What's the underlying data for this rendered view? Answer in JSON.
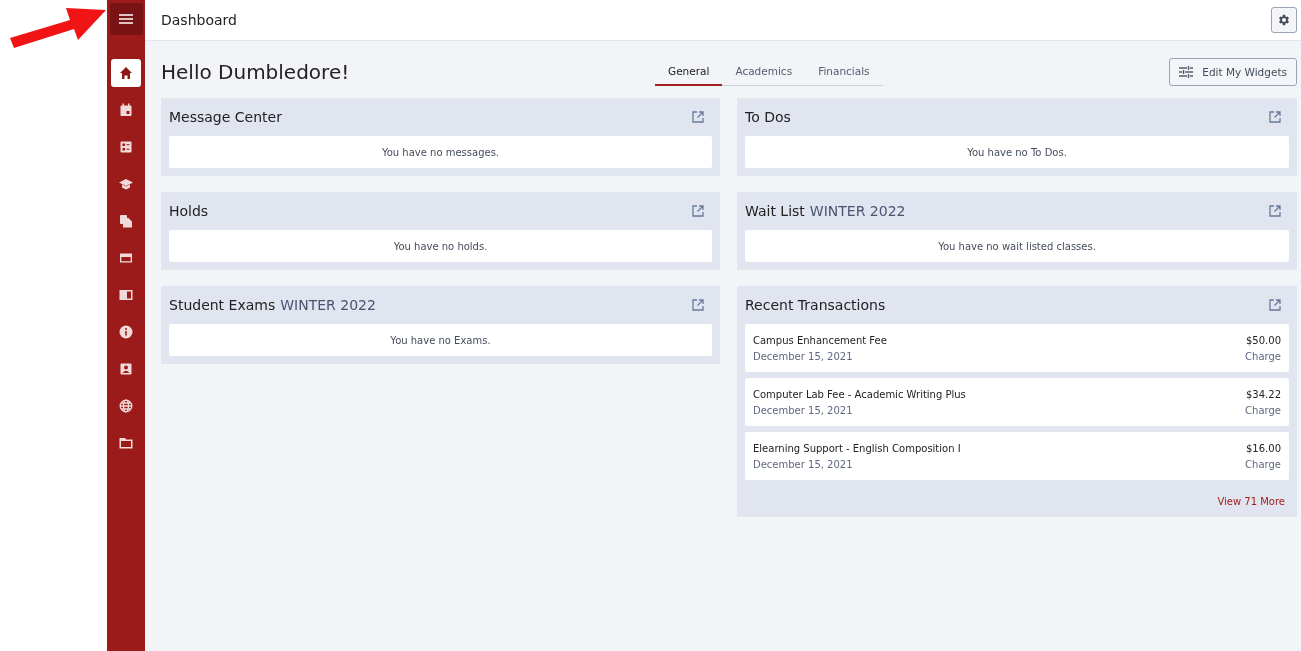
{
  "annotation": {
    "kind": "arrow"
  },
  "sidebar": {
    "items": [
      {
        "kind": "home",
        "selected": true
      },
      {
        "kind": "calendar",
        "selected": false
      },
      {
        "kind": "checklist",
        "selected": false
      },
      {
        "kind": "cap",
        "selected": false
      },
      {
        "kind": "documents",
        "selected": false
      },
      {
        "kind": "card",
        "selected": false
      },
      {
        "kind": "panel",
        "selected": false
      },
      {
        "kind": "info",
        "selected": false
      },
      {
        "kind": "contact",
        "selected": false
      },
      {
        "kind": "globe",
        "selected": false
      },
      {
        "kind": "folder",
        "selected": false
      }
    ]
  },
  "header": {
    "title": "Dashboard"
  },
  "greeting": "Hello Dumbledore!",
  "tabs": [
    {
      "label": "General",
      "selected": true
    },
    {
      "label": "Academics",
      "selected": false
    },
    {
      "label": "Financials",
      "selected": false
    }
  ],
  "edit_button": "Edit My Widgets",
  "columns": [
    [
      {
        "kind": "empty",
        "title": "Message Center",
        "message": "You have no messages."
      },
      {
        "kind": "empty",
        "title": "Holds",
        "message": "You have no holds."
      },
      {
        "kind": "empty",
        "title": "Student Exams",
        "term": "WINTER 2022",
        "message": "You have no Exams."
      }
    ],
    [
      {
        "kind": "empty",
        "title": "To Dos",
        "message": "You have no To Dos."
      },
      {
        "kind": "empty",
        "title": "Wait List",
        "term": "WINTER 2022",
        "message": "You have no wait listed classes."
      },
      {
        "kind": "transactions",
        "title": "Recent Transactions",
        "items": [
          {
            "name": "Campus Enhancement Fee",
            "date": "December 15, 2021",
            "amount": "$50.00",
            "type": "Charge"
          },
          {
            "name": "Computer Lab Fee - Academic Writing Plus",
            "date": "December 15, 2021",
            "amount": "$34.22",
            "type": "Charge"
          },
          {
            "name": "Elearning Support - English Composition I",
            "date": "December 15, 2021",
            "amount": "$16.00",
            "type": "Charge"
          }
        ],
        "link": "View 71 More"
      }
    ]
  ]
}
